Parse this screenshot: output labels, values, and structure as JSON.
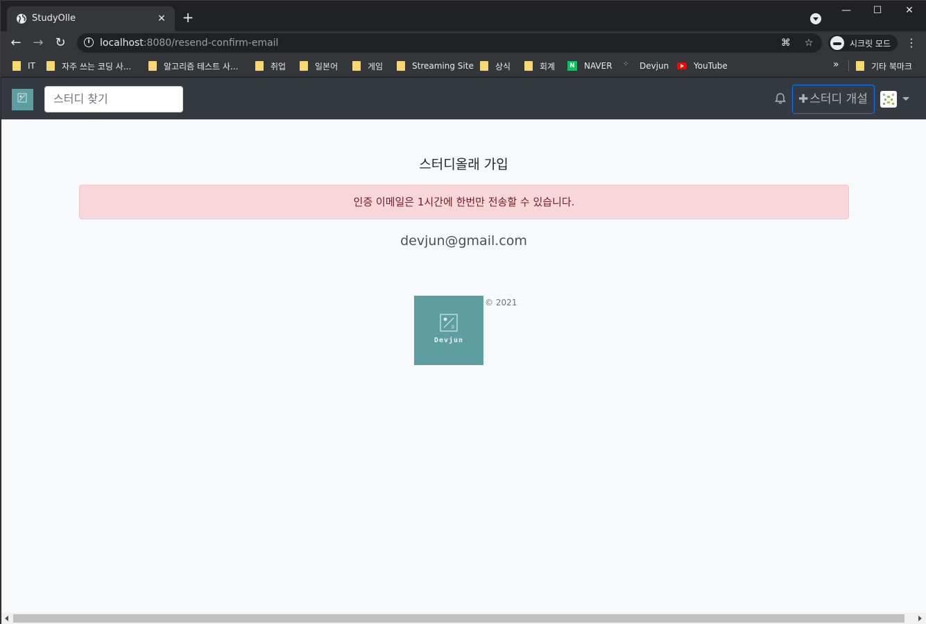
{
  "browser": {
    "tab_title": "StudyOlle",
    "url_host": "localhost",
    "url_rest": ":8080/resend-confirm-email",
    "incognito_label": "시크릿 모드",
    "bookmarks": [
      {
        "label": "IT",
        "icon": "folder-icon"
      },
      {
        "label": "자주 쓰는 코딩 사...",
        "icon": "folder-icon"
      },
      {
        "label": "알고리즘 테스트 사...",
        "icon": "folder-icon"
      },
      {
        "label": "취업",
        "icon": "folder-icon"
      },
      {
        "label": "일본어",
        "icon": "folder-icon"
      },
      {
        "label": "게임",
        "icon": "folder-icon"
      },
      {
        "label": "Streaming Site",
        "icon": "folder-icon"
      },
      {
        "label": "상식",
        "icon": "folder-icon"
      },
      {
        "label": "회계",
        "icon": "folder-icon"
      },
      {
        "label": "NAVER",
        "icon": "naver-icon"
      },
      {
        "label": "Devjun",
        "icon": "devjun-icon"
      },
      {
        "label": "YouTube",
        "icon": "youtube-icon"
      }
    ],
    "other_bookmarks": "기타 북마크",
    "bookmarks_more": "»"
  },
  "navbar": {
    "search_placeholder": "스터디 찾기",
    "create_study_label": "스터디 개설",
    "brand_color": "#5f9ea0",
    "navbar_bg": "#343a40"
  },
  "main": {
    "heading": "스터디올래 가입",
    "alert_message": "인증 이메일은 1시간에 한번만 전송할 수 있습니다.",
    "email": "devjun@gmail.com",
    "alert_bg": "#f8d7da",
    "alert_color": "#721c24"
  },
  "footer": {
    "logo_text": "Devjun",
    "copyright": "© 2021"
  }
}
